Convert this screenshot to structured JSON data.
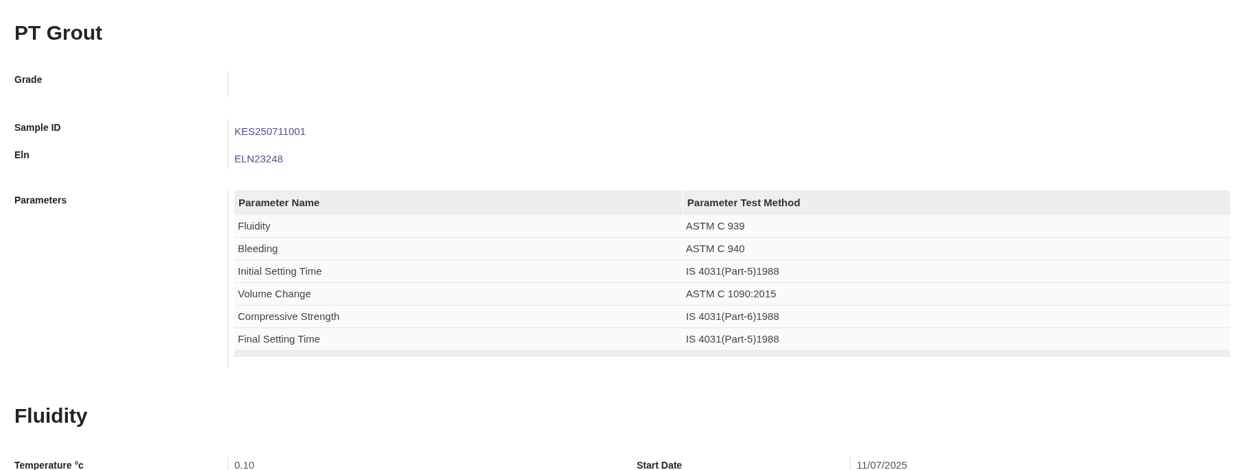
{
  "title": "PT Grout",
  "groups": [
    {
      "fields": [
        {
          "label": "Grade"
        }
      ]
    },
    {
      "fields": [
        {
          "label": "Sample ID",
          "value": "KES250711001",
          "kind": "link"
        },
        {
          "label": "Eln",
          "value": "ELN23248",
          "kind": "link"
        }
      ]
    }
  ],
  "parameters": {
    "label": "Parameters",
    "columns": [
      "Parameter Name",
      "Parameter Test Method"
    ],
    "rows": [
      [
        "Fluidity",
        "ASTM C 939"
      ],
      [
        "Bleeding",
        "ASTM C 940"
      ],
      [
        "Initial Setting Time",
        "IS 4031(Part-5)1988"
      ],
      [
        "Volume Change",
        "ASTM C 1090:2015"
      ],
      [
        "Compressive Strength",
        "IS 4031(Part-6)1988"
      ],
      [
        "Final Setting Time",
        "IS 4031(Part-5)1988"
      ]
    ]
  },
  "section": {
    "title": "Fluidity",
    "fields": [
      {
        "label": "Temperature °c",
        "value": "0.10"
      },
      {
        "label": "Start Date",
        "value": "11/07/2025"
      }
    ]
  }
}
